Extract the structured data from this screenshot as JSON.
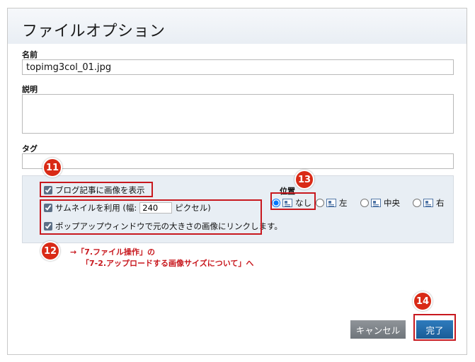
{
  "dialog": {
    "title": "ファイルオプション"
  },
  "fields": {
    "name_label": "名前",
    "name_value": "topimg3col_01.jpg",
    "description_label": "説明",
    "description_value": "",
    "tags_label": "タグ",
    "tags_value": ""
  },
  "options": {
    "show_in_post": {
      "label": "ブログ記事に画像を表示",
      "checked": true
    },
    "thumbnail": {
      "label_before": "サムネイルを利用 (幅:",
      "width": "240",
      "label_after": "ピクセル)",
      "checked": true
    },
    "popup": {
      "label": "ポップアップウィンドウで元の大きさの画像にリンクします。",
      "checked": true
    },
    "position": {
      "label": "位置",
      "selected": "none",
      "choices": [
        {
          "id": "none",
          "label": "なし",
          "icon": "align-none-icon"
        },
        {
          "id": "left",
          "label": "左",
          "icon": "align-left-icon"
        },
        {
          "id": "center",
          "label": "中央",
          "icon": "align-center-icon"
        },
        {
          "id": "right",
          "label": "右",
          "icon": "align-right-icon"
        }
      ]
    }
  },
  "annotations": {
    "badge_11": "11",
    "badge_12": "12",
    "badge_13": "13",
    "badge_14": "14",
    "note_line1": "→「7.ファイル操作」の",
    "note_line2": "「7-2.アップロードする画像サイズについて」へ",
    "color": "#c8181e"
  },
  "buttons": {
    "cancel": "キャンセル",
    "done": "完了"
  }
}
